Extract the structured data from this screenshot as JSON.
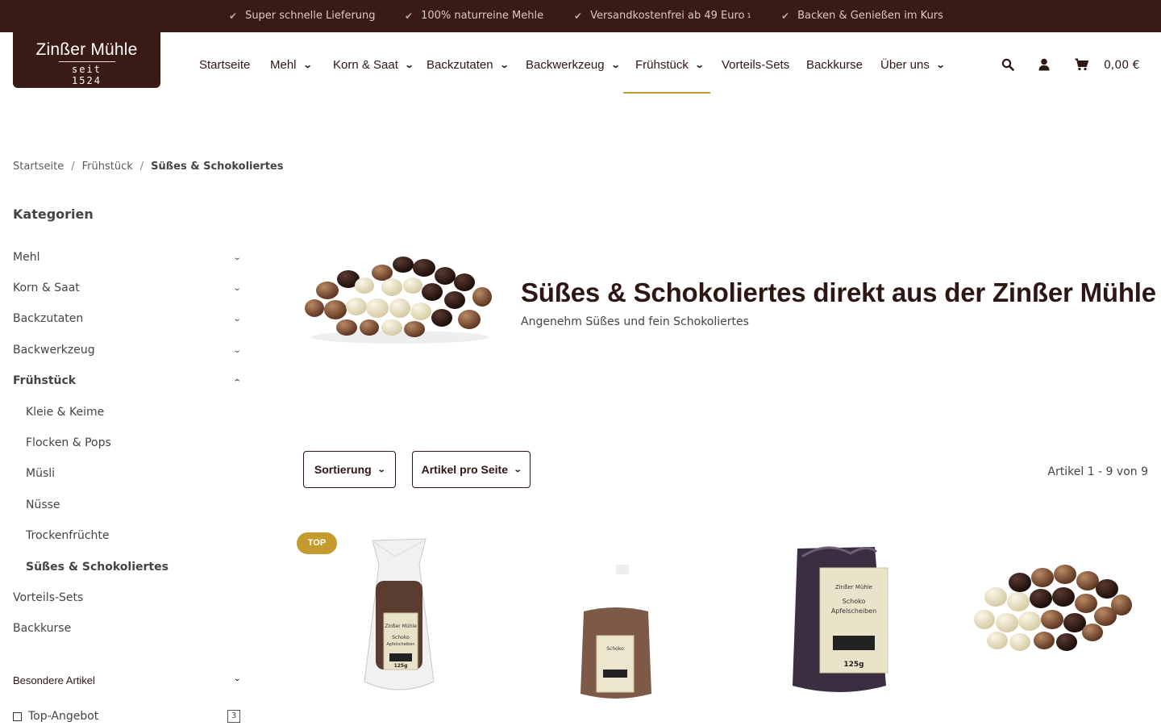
{
  "topbar": {
    "usps": [
      "Super schnelle Lieferung",
      "100% naturreine Mehle",
      "Versandkostenfrei ab 49 Euro",
      "Backen & Genießen im Kurs"
    ],
    "footnote": "1"
  },
  "logo": {
    "name": "Zinßer Mühle",
    "since": "seit 1524"
  },
  "nav": {
    "items": [
      "Startseite",
      "Mehl",
      "Korn & Saat",
      "Backzutaten",
      "Backwerkzeug",
      "Frühstück",
      "Vorteils-Sets",
      "Backkurse",
      "Über uns"
    ],
    "active": "Frühstück"
  },
  "header": {
    "cart_total": "0,00 €"
  },
  "breadcrumb": [
    "Startseite",
    "Frühstück",
    "Süßes & Schokoliertes"
  ],
  "sidebar": {
    "title": "Kategorien",
    "items": [
      "Mehl",
      "Korn & Saat",
      "Backzutaten",
      "Backwerkzeug",
      "Frühstück"
    ],
    "subitems": [
      "Kleie & Keime",
      "Flocken & Pops",
      "Müsli",
      "Nüsse",
      "Trockenfrüchte",
      "Süßes & Schokoliertes"
    ],
    "bottom_items": [
      "Vorteils-Sets",
      "Backkurse"
    ],
    "special_title": "Besondere Artikel",
    "filter_label": "Top-Angebot",
    "filter_count": "3"
  },
  "category": {
    "title": "Süßes & Schokoliertes direkt aus der Zinßer Mühle",
    "subtitle": "Angenehm Süßes und fein Schokoliertes"
  },
  "filters": {
    "sort_label": "Sortierung",
    "per_page_label": "Artikel pro Seite",
    "count_text": "Artikel 1 - 9 von 9"
  },
  "products": {
    "badge": "TOP",
    "pack_brand": "Zinßer Mühle",
    "pack_name_1": "Schoko",
    "pack_name_2": "Apfelscheiben",
    "pack_weight": "125g"
  },
  "colors": {
    "brand_dark": "#3a1a14",
    "accent_gold": "#c59a2e"
  }
}
